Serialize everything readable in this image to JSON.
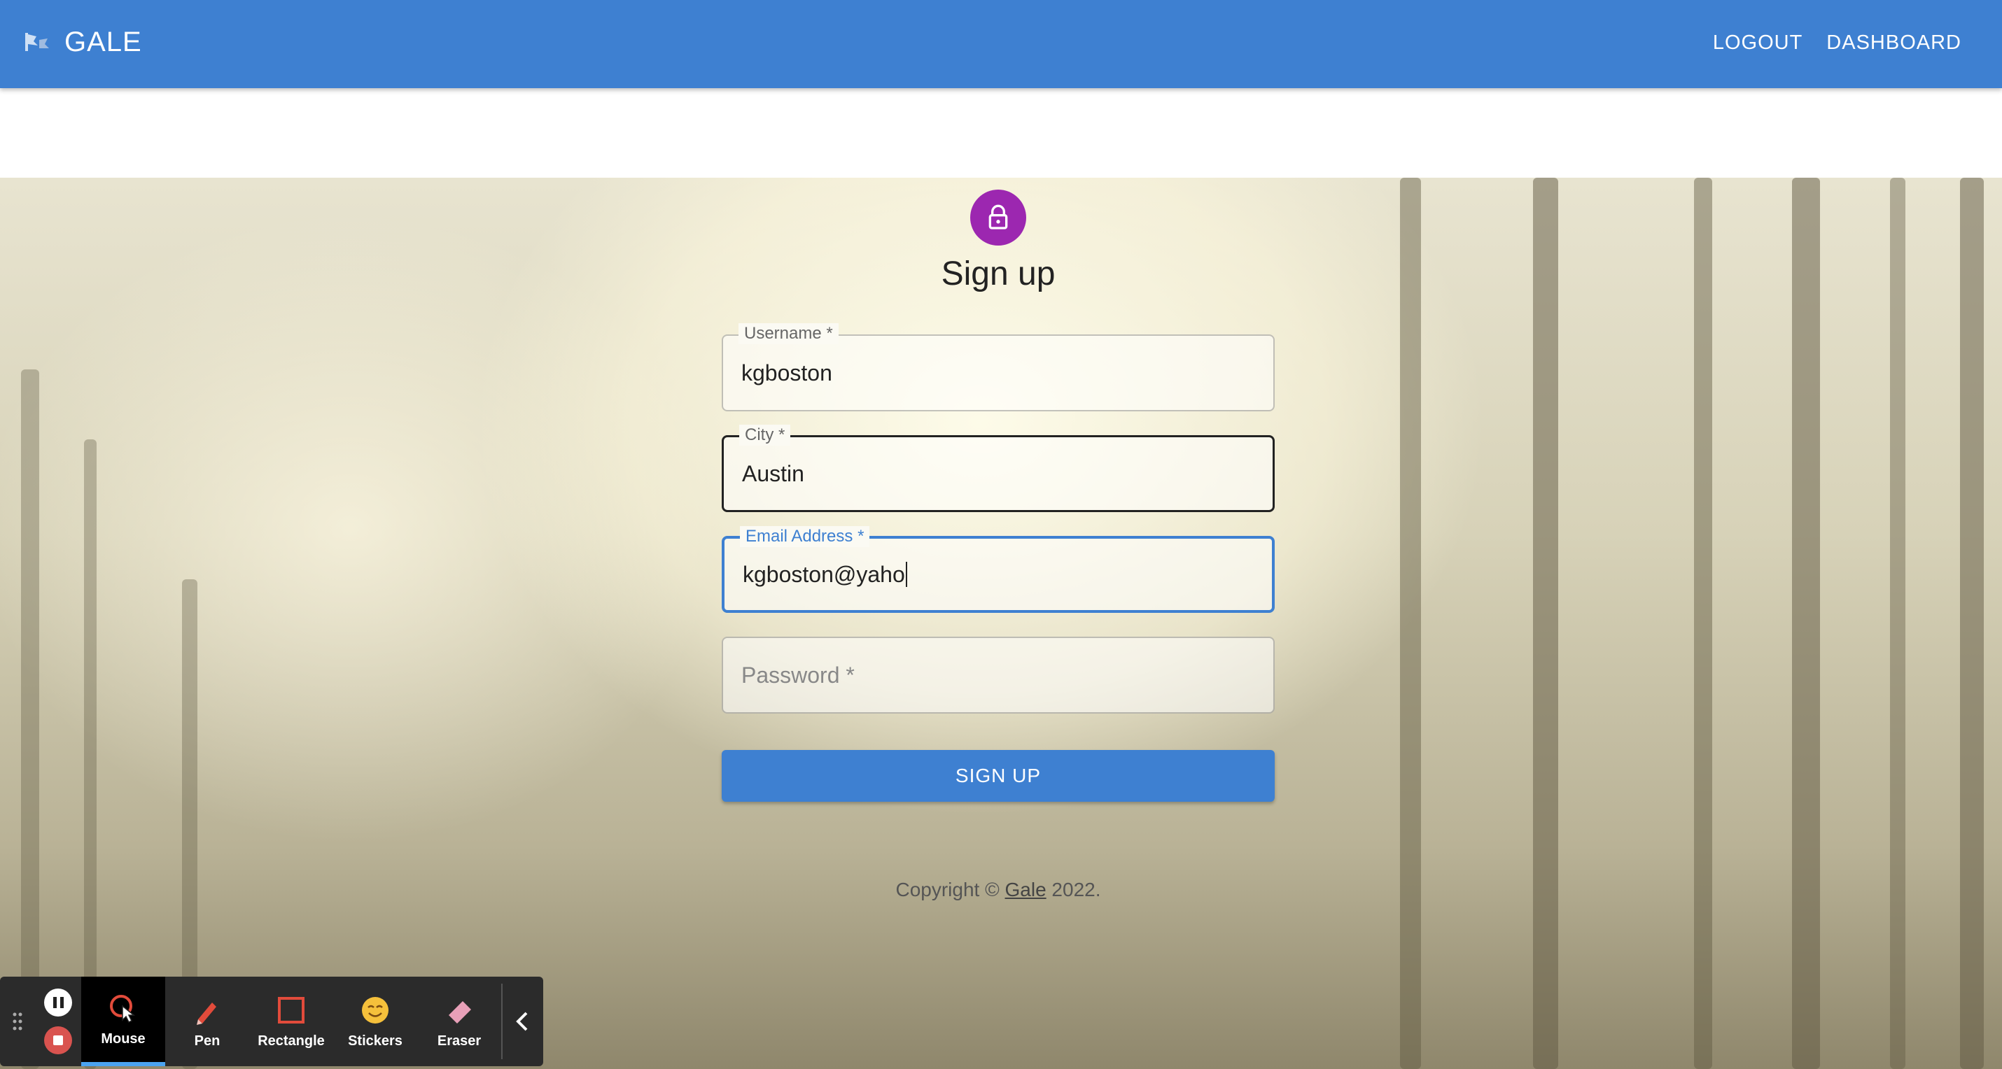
{
  "app": {
    "title": "GALE"
  },
  "nav": {
    "logout": "LOGOUT",
    "dashboard": "DASHBOARD"
  },
  "form": {
    "heading": "Sign up",
    "username": {
      "label": "Username *",
      "value": "kgboston"
    },
    "city": {
      "label": "City *",
      "value": "Austin"
    },
    "email": {
      "label": "Email Address *",
      "value": "kgboston@yaho"
    },
    "password": {
      "placeholder": "Password *"
    },
    "submit": "SIGN UP"
  },
  "footer": {
    "prefix": "Copyright © ",
    "link": "Gale",
    "suffix": " 2022."
  },
  "toolbar": {
    "tools": [
      {
        "label": "Mouse",
        "icon": "mouse-cursor-icon",
        "active": true
      },
      {
        "label": "Pen",
        "icon": "pen-icon"
      },
      {
        "label": "Rectangle",
        "icon": "rectangle-icon"
      },
      {
        "label": "Stickers",
        "icon": "sticker-icon"
      },
      {
        "label": "Eraser",
        "icon": "eraser-icon"
      }
    ]
  },
  "colors": {
    "primary": "#3e80d1",
    "avatar": "#9c27b0",
    "toolbar": "#2b2b2b"
  }
}
